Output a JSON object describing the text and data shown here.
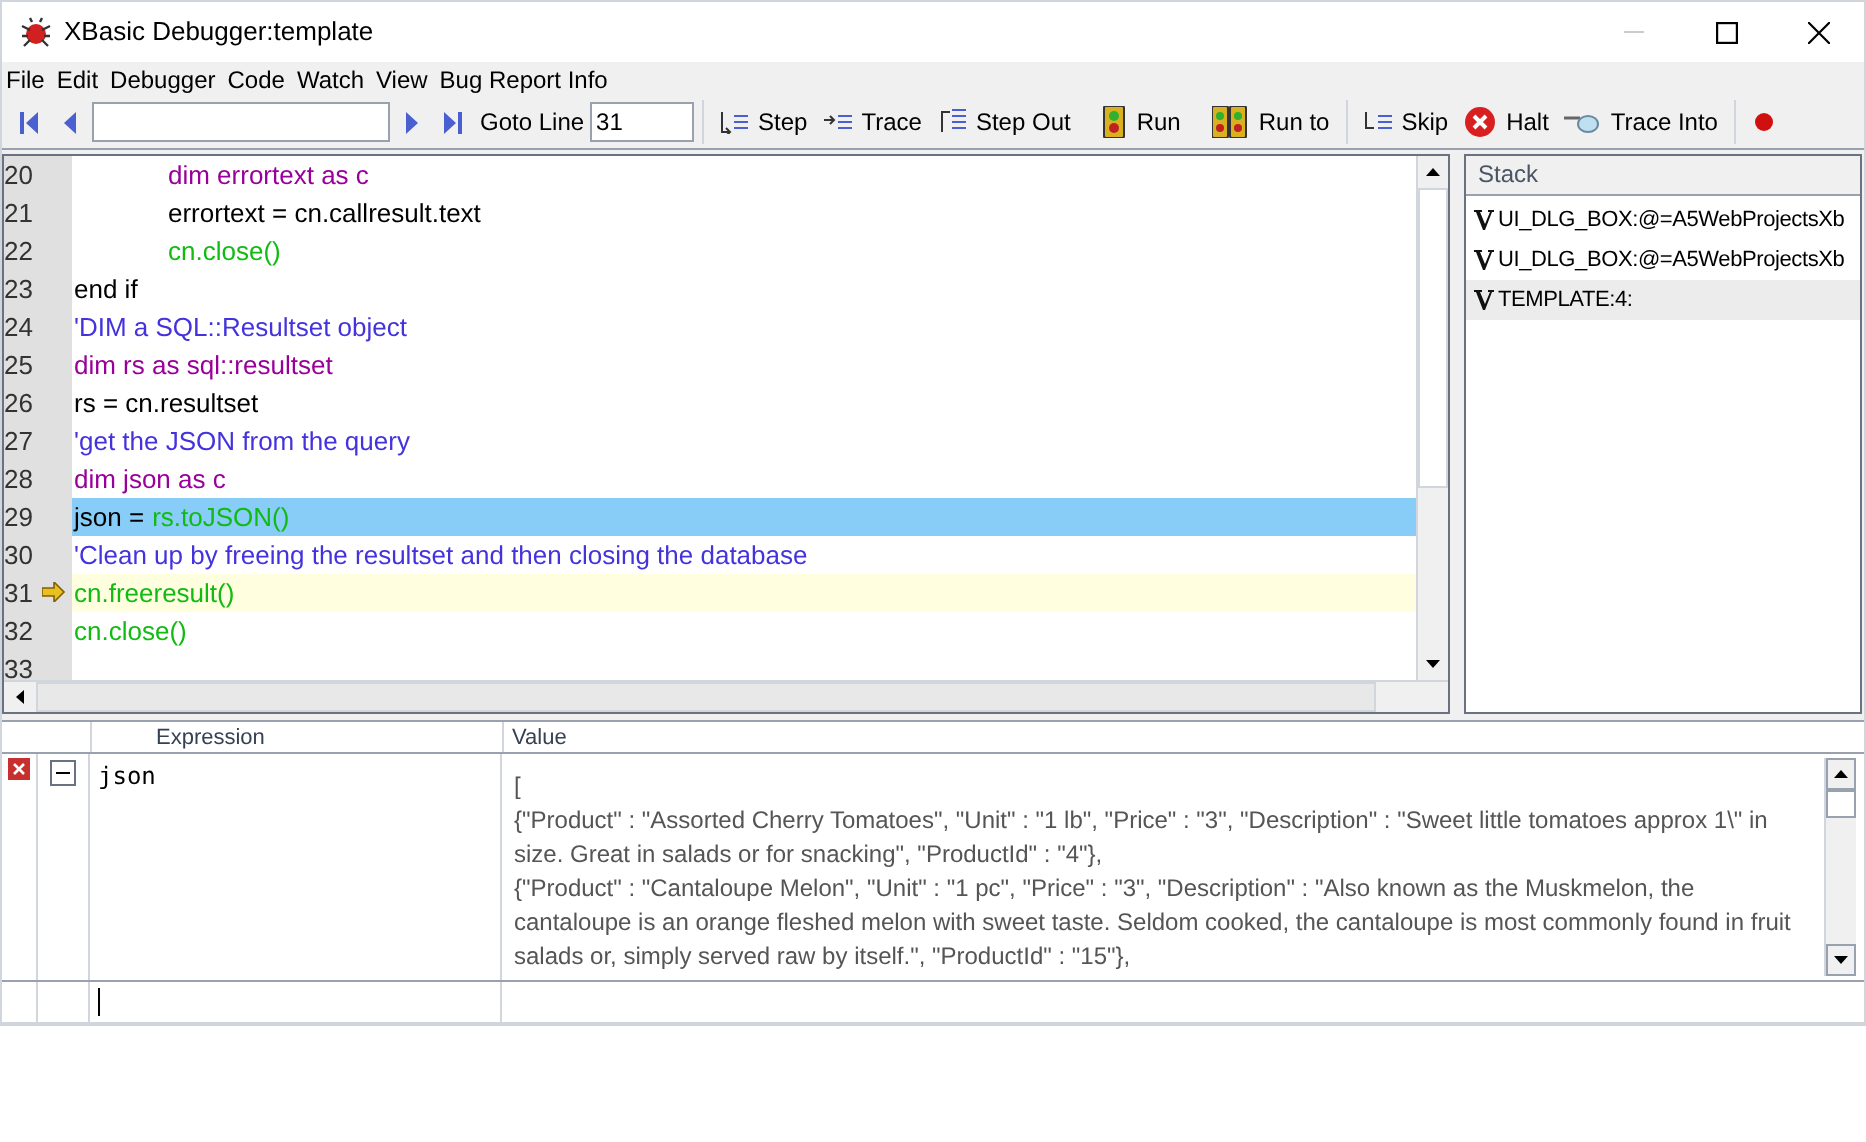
{
  "window": {
    "title": "XBasic Debugger:template"
  },
  "menu": [
    "File",
    "Edit",
    "Debugger",
    "Code",
    "Watch",
    "View",
    "Bug Report Info"
  ],
  "toolbar": {
    "goto_label": "Goto Line",
    "goto_value": "31",
    "buttons": [
      {
        "label": "Step",
        "kind": "step"
      },
      {
        "label": "Trace",
        "kind": "trace"
      },
      {
        "label": "Step Out",
        "kind": "stepout"
      },
      {
        "label": "Run",
        "kind": "run"
      },
      {
        "label": "Run to",
        "kind": "runto"
      },
      {
        "label": "Skip",
        "kind": "skip"
      },
      {
        "label": "Halt",
        "kind": "halt"
      },
      {
        "label": "Trace Into",
        "kind": "traceinto"
      }
    ]
  },
  "code": {
    "lines": [
      {
        "number": "20",
        "indented": true,
        "selected": false,
        "current": false,
        "segments": [
          {
            "text": "dim errortext as c",
            "kind": "keyword"
          }
        ]
      },
      {
        "number": "21",
        "indented": true,
        "selected": false,
        "current": false,
        "segments": [
          {
            "text": "errortext = cn.callresult.text",
            "kind": "plain"
          }
        ]
      },
      {
        "number": "22",
        "indented": true,
        "selected": false,
        "current": false,
        "segments": [
          {
            "text": "cn.close()",
            "kind": "call"
          }
        ]
      },
      {
        "number": "23",
        "indented": false,
        "selected": false,
        "current": false,
        "segments": [
          {
            "text": "end if",
            "kind": "plain"
          }
        ]
      },
      {
        "number": "24",
        "indented": false,
        "selected": false,
        "current": false,
        "segments": [
          {
            "text": "'DIM a SQL::Resultset object",
            "kind": "comment"
          }
        ]
      },
      {
        "number": "25",
        "indented": false,
        "selected": false,
        "current": false,
        "segments": [
          {
            "text": "dim rs as sql::resultset",
            "kind": "keyword"
          }
        ]
      },
      {
        "number": "26",
        "indented": false,
        "selected": false,
        "current": false,
        "segments": [
          {
            "text": "rs = cn.resultset",
            "kind": "plain"
          }
        ]
      },
      {
        "number": "27",
        "indented": false,
        "selected": false,
        "current": false,
        "segments": [
          {
            "text": "'get the JSON from the query",
            "kind": "comment"
          }
        ]
      },
      {
        "number": "28",
        "indented": false,
        "selected": false,
        "current": false,
        "segments": [
          {
            "text": "dim json as c",
            "kind": "keyword"
          }
        ]
      },
      {
        "number": "29",
        "indented": false,
        "selected": true,
        "current": false,
        "segments": [
          {
            "text": "json =",
            "kind": "plain"
          },
          {
            "text": "rs.toJSON()",
            "kind": "call"
          }
        ]
      },
      {
        "number": "30",
        "indented": false,
        "selected": false,
        "current": false,
        "segments": [
          {
            "text": "'Clean up by freeing the resultset and then closing the database",
            "kind": "comment"
          }
        ]
      },
      {
        "number": "31",
        "indented": false,
        "selected": false,
        "current": true,
        "segments": [
          {
            "text": "cn.freeresult()",
            "kind": "call"
          }
        ]
      },
      {
        "number": "32",
        "indented": false,
        "selected": false,
        "current": false,
        "segments": [
          {
            "text": "cn.close()",
            "kind": "call"
          }
        ]
      },
      {
        "number": "33",
        "selected": false,
        "current": false
      }
    ]
  },
  "stack": {
    "title": "Stack",
    "items": [
      {
        "label": "UI_DLG_BOX:@=A5WebProjectsXb",
        "selected": false
      },
      {
        "label": "UI_DLG_BOX:@=A5WebProjectsXb",
        "selected": false
      },
      {
        "label": "TEMPLATE:4:",
        "selected": true
      }
    ]
  },
  "watch": {
    "columns": [
      "Expression",
      "Value"
    ],
    "rows": [
      {
        "expression": "json",
        "expanded": true,
        "value_lines": [
          "[",
          "{\"Product\" : \"Assorted Cherry Tomatoes\", \"Unit\" : \"1 lb\", \"Price\" : \"3\", \"Description\" : \"Sweet little tomatoes approx 1\\\" in size. Great in salads or for snacking\", \"ProductId\" : \"4\"},",
          "{\"Product\" : \"Cantaloupe Melon\", \"Unit\" : \"1 pc\", \"Price\" : \"3\", \"Description\" : \"Also known as the Muskmelon, the cantaloupe is an orange fleshed melon with sweet taste. Seldom cooked, the cantaloupe is most commonly found in fruit salads or, simply served raw by itself.\", \"ProductId\" : \"15\"},"
        ]
      }
    ]
  }
}
